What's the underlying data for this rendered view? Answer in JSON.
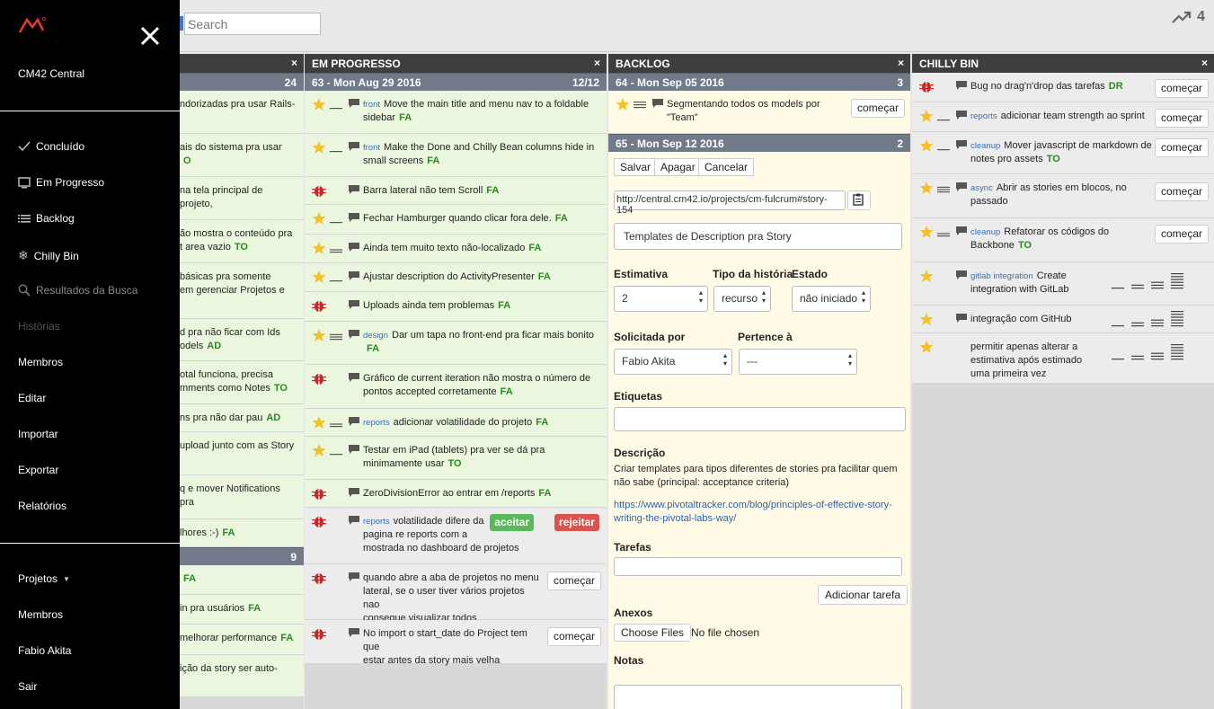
{
  "search": {
    "placeholder": "Search"
  },
  "velocity": {
    "value": "4"
  },
  "sidebar": {
    "app": "CM42 Central",
    "items": [
      "Concluído",
      "Em Progresso",
      "Backlog",
      "Chilly Bin",
      "Resultados da Busca",
      "Histórias",
      "Membros",
      "Editar",
      "Importar",
      "Exportar",
      "Relatórios"
    ],
    "bottom": [
      "Projetos",
      "Membros",
      "Fabio Akita",
      "Sair"
    ]
  },
  "done_col": {
    "count": "24",
    "count2": "9",
    "rows": [
      {
        "t1": "ndorizadas pra usar Rails-",
        "t2": ""
      },
      {
        "t1": "ais do sistema pra usar",
        "t2": "",
        "own": "O"
      },
      {
        "t1": "na tela principal de projeto,",
        "t2": ""
      },
      {
        "t1": "ão mostra o conteúdo pra",
        "t2": "t area vazio",
        "own": "TO"
      },
      {
        "t1": "básicas pra somente",
        "t2": "em gerenciar Projetos e"
      },
      {
        "t1": "d pra não ficar com Ids",
        "t2": "odels",
        "own": "AD"
      },
      {
        "t1": "otal funciona, precisa",
        "t2": "mments como Notes",
        "own": "TO"
      },
      {
        "t1": "ns pra não dar pau",
        "own": "AD"
      },
      {
        "t1": "upload junto com as Story",
        "t2": ""
      },
      {
        "t1": "q e mover Notifications pra",
        "t2": ""
      },
      {
        "t1": "lhores :-)",
        "own": "FA"
      },
      {
        "t1": "",
        "own": "FA"
      },
      {
        "t1": "in pra usuários",
        "own": "FA"
      },
      {
        "t1": "melhorar performance",
        "own": "FA"
      },
      {
        "t1": "ição da story ser auto-",
        "t2": ""
      }
    ]
  },
  "inprogress": {
    "header": "EM PROGRESSO",
    "iteration": "63 - Mon Aug 29 2016",
    "points": "12/12",
    "stories": [
      {
        "label": "front",
        "t1": "Move the main title and menu nav to a foldable",
        "t2": "sidebar",
        "own": "FA"
      },
      {
        "label": "front",
        "t1": "Make the Done and Chilly Bean columns hide in",
        "t2": "small screens",
        "own": "FA"
      },
      {
        "t1": "Barra lateral não tem Scroll",
        "own": "FA"
      },
      {
        "t1": "Fechar Hamburger quando clicar fora dele.",
        "own": "FA"
      },
      {
        "t1": "Ainda tem muito texto não-localizado",
        "own": "FA"
      },
      {
        "t1": "Ajustar description do ActivityPresenter",
        "own": "FA"
      },
      {
        "t1": "Uploads ainda tem problemas",
        "own": "FA"
      },
      {
        "label": "design",
        "t1": "Dar um tapa no front-end pra ficar mais bonito",
        "t2": "",
        "own": "FA"
      },
      {
        "t1": "Gráfico de current iteration não mostra o número de",
        "t2": "pontos accepted corretamente",
        "own": "FA"
      },
      {
        "label": "reports",
        "t1": "adicionar volatilidade do projeto",
        "own": "FA"
      },
      {
        "t1": "Testar em iPad (tablets) pra ver se dá pra",
        "t2": "minimamente usar",
        "own": "TO"
      },
      {
        "t1": "ZeroDivisionError ao entrar em /reports",
        "own": "FA"
      },
      {
        "label": "reports",
        "t1": "volatilidade difere da",
        "t2": "pagina re reports com a",
        "t3": "mostrada no dashboard de projetos",
        "accept": "aceitar",
        "reject": "rejeitar"
      },
      {
        "t1": "quando abre a aba de projetos no menu",
        "t2": "lateral, se o user tiver vários projetos nao",
        "t3": "consegue visualizar todos",
        "start": "começar"
      },
      {
        "t1": "No import o start_date do Project tem que",
        "t2": "estar antes da story mais velha",
        "start": "começar"
      }
    ]
  },
  "backlog": {
    "header": "BACKLOG",
    "iteration1": "64 - Mon Sep 05 2016",
    "points1": "3",
    "story1": {
      "t1": "Segmentando todos os models por",
      "t2": "\"Team\"",
      "start": "começar"
    },
    "iteration2": "65 - Mon Sep 12 2016",
    "points2": "2",
    "form": {
      "save": "Salvar",
      "delete": "Apagar",
      "cancel": "Cancelar",
      "url": "http://central.cm42.io/projects/cm-fulcrum#story-154",
      "title": "Templates de Description pra Story",
      "estimate_label": "Estimativa",
      "estimate": "2",
      "type_label": "Tipo da história",
      "type": "recurso",
      "state_label": "Estado",
      "state": "não iniciado",
      "requested_label": "Solicitada por",
      "requested": "Fabio Akita",
      "owner_label": "Pertence à",
      "owner": "---",
      "tags_label": "Etiquetas",
      "desc_label": "Descrição",
      "desc1": "Criar templates para tipos diferentes de stories pra facilitar quem",
      "desc2": "não sabe (principal: acceptance criteria)",
      "link1": "https://www.pivotaltracker.com/blog/principles-of-effective-story-",
      "link2": "writing-the-pivotal-labs-way/",
      "tasks_label": "Tarefas",
      "add_task": "Adicionar tarefa",
      "attach_label": "Anexos",
      "choose": "Choose Files",
      "nofile": "No file chosen",
      "notes_label": "Notas"
    }
  },
  "chilly": {
    "header": "CHILLY BIN",
    "stories": [
      {
        "t1": "Bug no drag'n'drop das tarefas",
        "own": "DR",
        "start": "começar"
      },
      {
        "label": "reports",
        "t1": "adicionar team strength ao sprint",
        "start": "começar"
      },
      {
        "label": "cleanup",
        "t1": "Mover javascript de markdown de",
        "t2": "notes pro assets",
        "own": "TO",
        "start": "começar"
      },
      {
        "label": "async",
        "t1": "Abrir as stories em blocos, no",
        "t2": "passado",
        "start": "começar"
      },
      {
        "label": "cleanup",
        "t1": "Refatorar os códigos do",
        "t2": "Backbone",
        "own": "TO",
        "start": "começar"
      },
      {
        "label": "gitlab integration",
        "t1": "Create",
        "t2": "integration with GitLab"
      },
      {
        "t1": "integração com GitHub"
      },
      {
        "t1": "permitir apenas alterar a",
        "t2": "estimativa após estimado",
        "t3": "uma primeira vez"
      }
    ]
  }
}
